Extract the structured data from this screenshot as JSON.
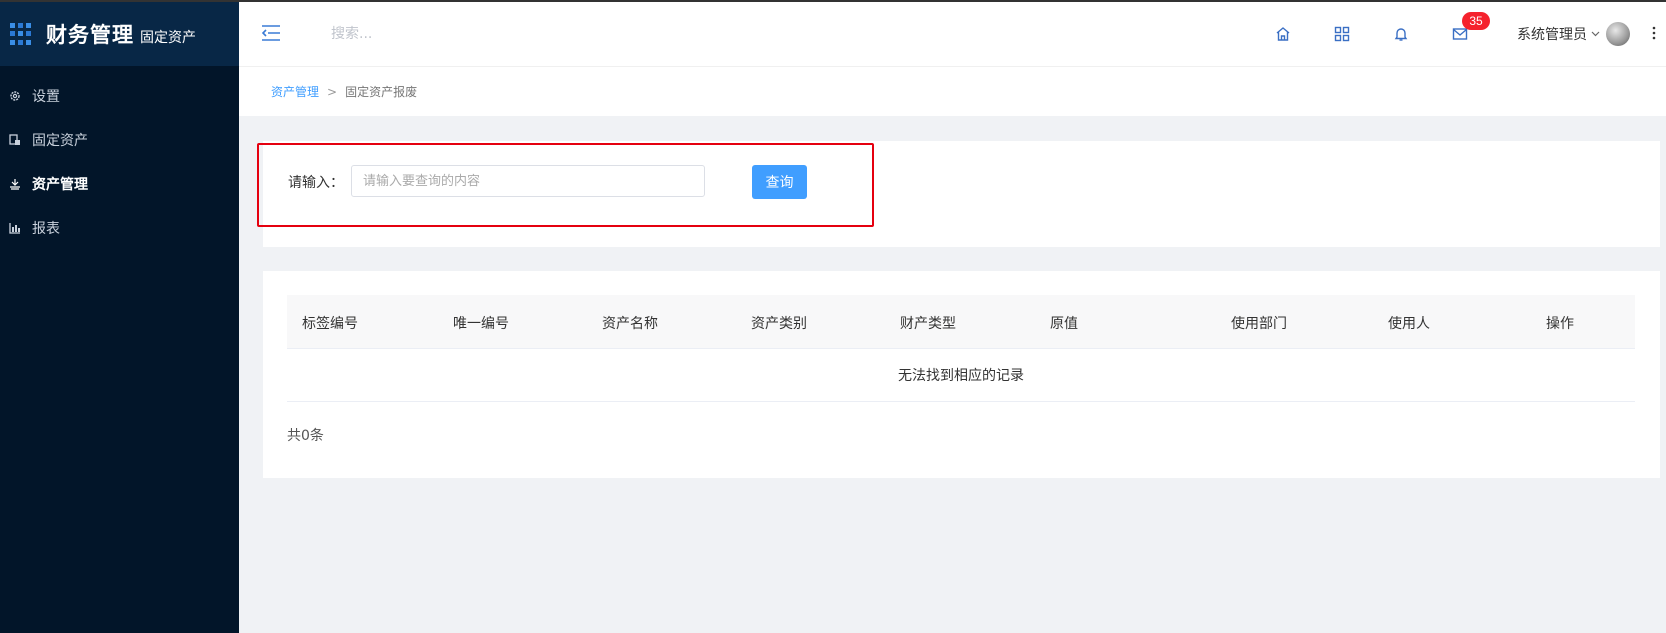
{
  "sidebar": {
    "brand_title": "财务管理",
    "brand_sub": "固定资产",
    "items": [
      {
        "label": "设置",
        "icon": "gear-icon"
      },
      {
        "label": "固定资产",
        "icon": "asset-icon"
      },
      {
        "label": "资产管理",
        "icon": "manage-icon"
      },
      {
        "label": "报表",
        "icon": "chart-icon"
      }
    ],
    "active_index": 2
  },
  "header": {
    "search_placeholder": "搜索...",
    "message_count": "35",
    "username": "系统管理员"
  },
  "breadcrumb": {
    "parent": "资产管理",
    "separator": ">",
    "current": "固定资产报废"
  },
  "search_form": {
    "label": "请输入：",
    "placeholder": "请输入要查询的内容",
    "value": "",
    "button_label": "查询"
  },
  "table": {
    "columns": [
      "标签编号",
      "唯一编号",
      "资产名称",
      "资产类别",
      "财产类型",
      "原值",
      "使用部门",
      "使用人",
      "操作"
    ],
    "empty_text": "无法找到相应的记录",
    "total_text": "共0条"
  },
  "colors": {
    "sidebar_bg": "#021529",
    "brand_bg": "#082746",
    "accent": "#409eff",
    "highlight": "#e5000f",
    "badge": "#f5222d"
  }
}
